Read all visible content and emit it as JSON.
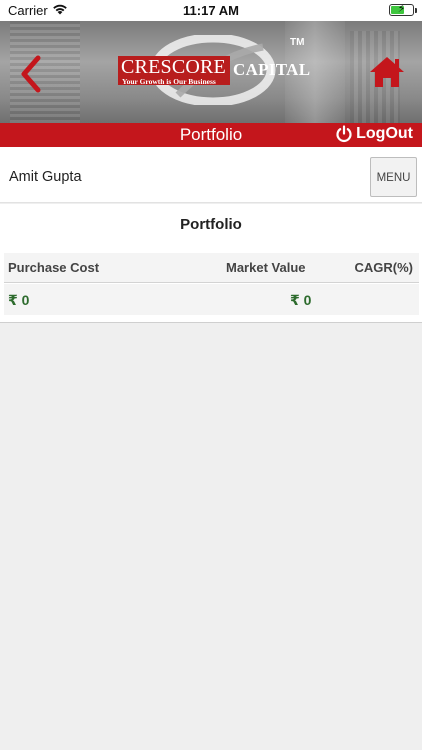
{
  "status_bar": {
    "carrier": "Carrier",
    "time": "11:17 AM",
    "battery_level": 0.65
  },
  "header": {
    "brand_word_1": "CRESCORE",
    "brand_word_2": "CAPITAL",
    "trademark": "TM",
    "tagline": "Your Growth is Our Business",
    "back_icon": "chevron-left-icon",
    "home_icon": "home-icon",
    "accent_color": "#c4161c"
  },
  "title_bar": {
    "title": "Portfolio",
    "logout_label": "LogOut",
    "logout_icon": "power-icon"
  },
  "user_bar": {
    "user_name": "Amit Gupta",
    "menu_label": "MENU"
  },
  "portfolio": {
    "heading": "Portfolio",
    "columns": [
      "Purchase Cost",
      "Market Value",
      "CAGR(%)"
    ],
    "rows": [
      {
        "purchase_cost": "₹ 0",
        "market_value": "₹ 0",
        "cagr": ""
      }
    ],
    "value_color": "#2d6b2d"
  }
}
